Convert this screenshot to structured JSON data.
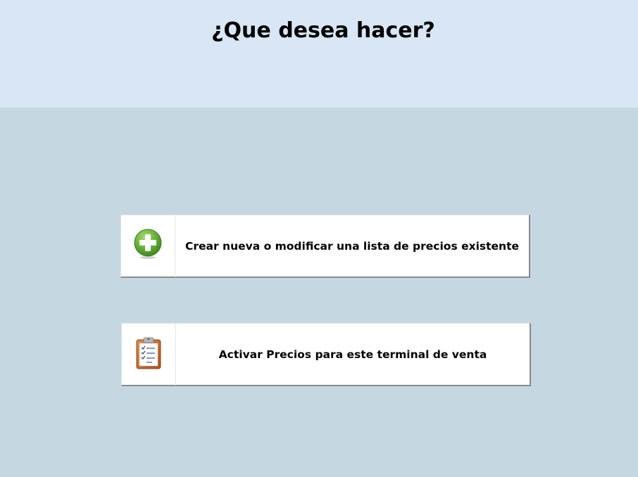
{
  "header": {
    "title": "¿Que desea hacer?"
  },
  "options": [
    {
      "label": "Crear nueva o modificar una lista de precios existente",
      "icon": "add-icon"
    },
    {
      "label": "Activar Precios para este terminal de venta",
      "icon": "clipboard-checklist-icon"
    }
  ],
  "colors": {
    "header_bg": "#d8e6f5",
    "body_bg": "#c5d8e1",
    "add_icon_green": "#6ab23c",
    "clipboard_orange": "#c8692c"
  }
}
